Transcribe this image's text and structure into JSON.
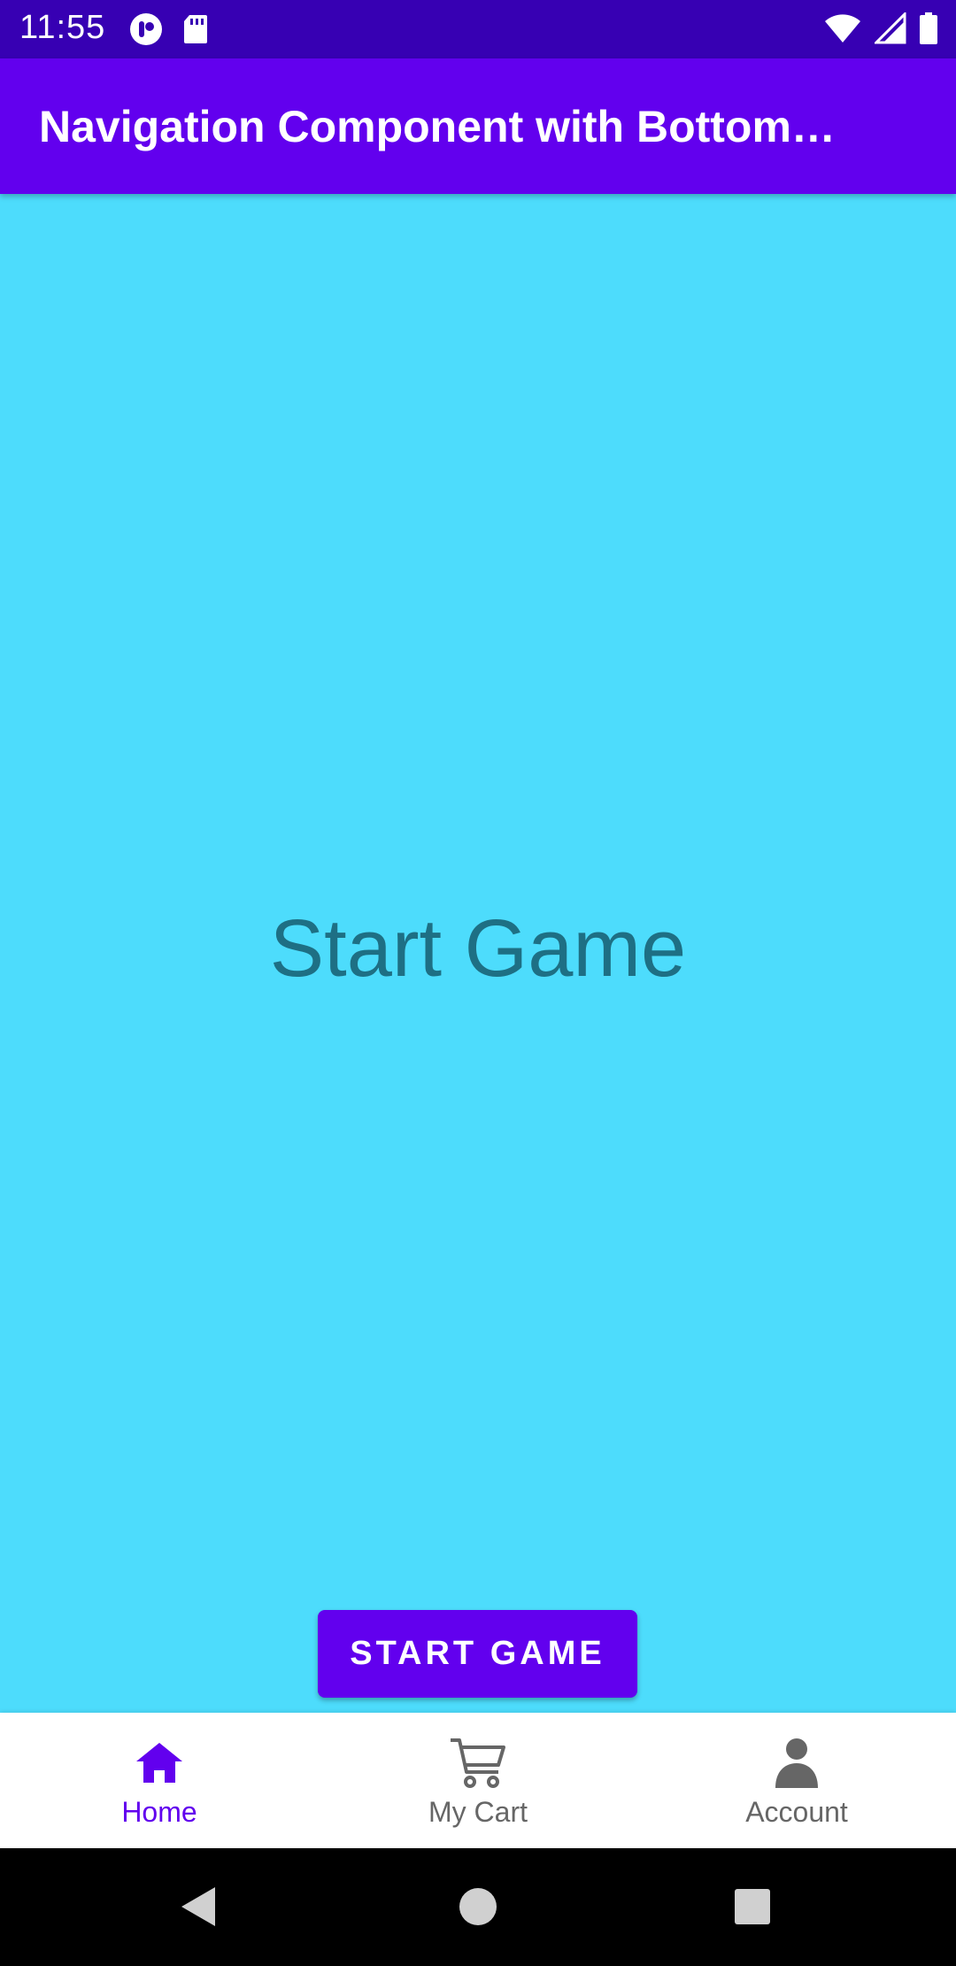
{
  "status_bar": {
    "time": "11:55",
    "icons": [
      "notification-app-icon",
      "sd-card-icon",
      "wifi-icon",
      "cellular-signal-icon",
      "battery-icon"
    ]
  },
  "app_bar": {
    "title": "Navigation Component with Bottom…"
  },
  "content": {
    "headline": "Start Game",
    "button_label": "START GAME"
  },
  "bottom_nav": {
    "items": [
      {
        "label": "Home",
        "icon": "home-icon",
        "selected": true
      },
      {
        "label": "My Cart",
        "icon": "cart-icon",
        "selected": false
      },
      {
        "label": "Account",
        "icon": "account-icon",
        "selected": false
      }
    ]
  },
  "colors": {
    "status_bar": "#3700b3",
    "app_bar": "#6200ee",
    "content_background": "#4ddcfc",
    "headline_text": "#1e6f84",
    "nav_selected": "#6200ee",
    "nav_unselected": "#666666"
  },
  "system_nav": {
    "buttons": [
      "back-icon",
      "home-circle-icon",
      "recents-icon"
    ]
  }
}
